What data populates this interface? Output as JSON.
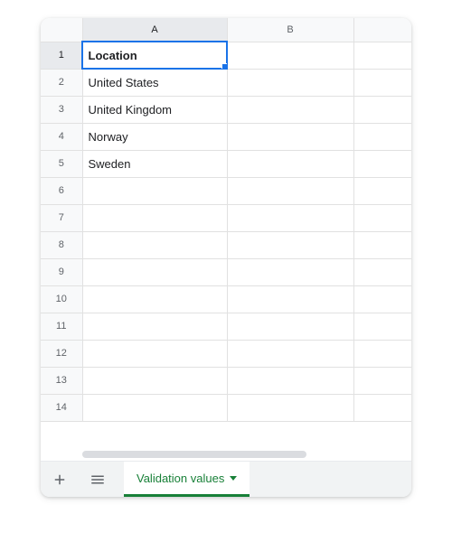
{
  "columns": [
    "A",
    "B"
  ],
  "active_column_index": 0,
  "row_count": 14,
  "active_row_index": 0,
  "cells": {
    "A1": {
      "value": "Location",
      "bold": true
    },
    "A2": {
      "value": "United States"
    },
    "A3": {
      "value": "United Kingdom"
    },
    "A4": {
      "value": "Norway"
    },
    "A5": {
      "value": "Sweden"
    }
  },
  "selected_cell": "A1",
  "footer": {
    "add_sheet_tooltip": "Add sheet",
    "all_sheets_tooltip": "All sheets",
    "active_tab_label": "Validation values"
  },
  "colors": {
    "selection": "#1a73e8",
    "tab_accent": "#188038"
  }
}
